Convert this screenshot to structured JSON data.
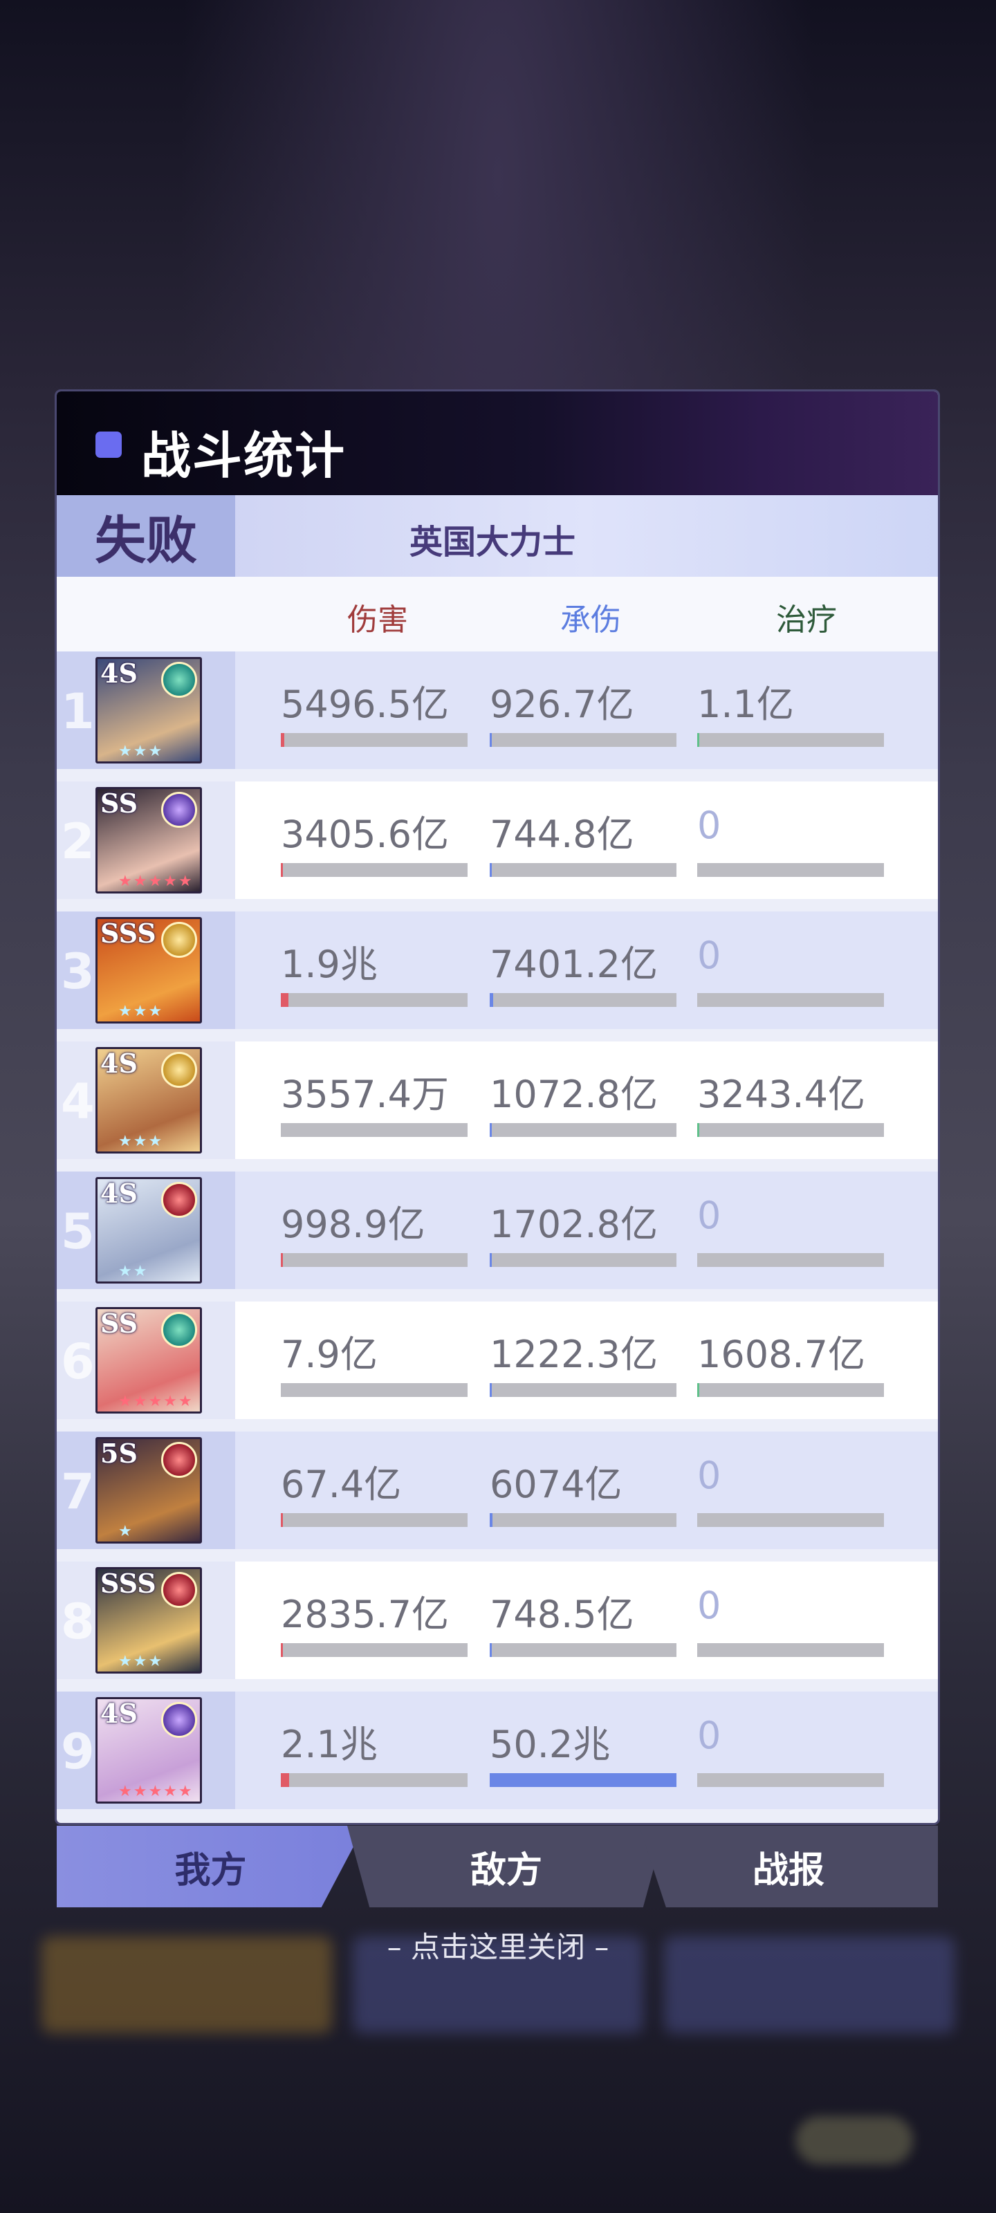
{
  "title": "战斗统计",
  "result": "失败",
  "opponent": "英国大力士",
  "columns": {
    "damage": "伤害",
    "tank": "承伤",
    "heal": "治疗"
  },
  "colors": {
    "damage": "#e05a66",
    "tank": "#6a86e6",
    "heal": "#5fc08a"
  },
  "rows": [
    {
      "rank": "1",
      "grade": "4S",
      "element": "wind",
      "stars": "★★★",
      "damage": "5496.5亿",
      "tank": "926.7亿",
      "heal": "1.1亿",
      "damage_ratio": 0.02,
      "tank_ratio": 0.01,
      "heal_ratio": 0.005
    },
    {
      "rank": "2",
      "grade": "SS",
      "element": "moon",
      "stars": "★★★★★",
      "damage": "3405.6亿",
      "tank": "744.8亿",
      "heal": "0",
      "damage_ratio": 0.012,
      "tank_ratio": 0.01,
      "heal_ratio": 0
    },
    {
      "rank": "3",
      "grade": "SSS",
      "element": "light",
      "stars": "★★★",
      "damage": "1.9兆",
      "tank": "7401.2亿",
      "heal": "0",
      "damage_ratio": 0.04,
      "tank_ratio": 0.02,
      "heal_ratio": 0
    },
    {
      "rank": "4",
      "grade": "4S",
      "element": "light",
      "stars": "★★★",
      "damage": "3557.4万",
      "tank": "1072.8亿",
      "heal": "3243.4亿",
      "damage_ratio": 0,
      "tank_ratio": 0.01,
      "heal_ratio": 0.01
    },
    {
      "rank": "5",
      "grade": "4S",
      "element": "fire",
      "stars": "★★",
      "damage": "998.9亿",
      "tank": "1702.8亿",
      "heal": "0",
      "damage_ratio": 0.005,
      "tank_ratio": 0.01,
      "heal_ratio": 0
    },
    {
      "rank": "6",
      "grade": "SS",
      "element": "wind",
      "stars": "★★★★★",
      "damage": "7.9亿",
      "tank": "1222.3亿",
      "heal": "1608.7亿",
      "damage_ratio": 0,
      "tank_ratio": 0.01,
      "heal_ratio": 0.01
    },
    {
      "rank": "7",
      "grade": "5S",
      "element": "fire",
      "stars": "★",
      "damage": "67.4亿",
      "tank": "6074亿",
      "heal": "0",
      "damage_ratio": 0.003,
      "tank_ratio": 0.015,
      "heal_ratio": 0
    },
    {
      "rank": "8",
      "grade": "SSS",
      "element": "fire",
      "stars": "★★★",
      "damage": "2835.7亿",
      "tank": "748.5亿",
      "heal": "0",
      "damage_ratio": 0.012,
      "tank_ratio": 0.01,
      "heal_ratio": 0
    },
    {
      "rank": "9",
      "grade": "4S",
      "element": "moon",
      "stars": "★★★★★",
      "damage": "2.1兆",
      "tank": "50.2兆",
      "heal": "0",
      "damage_ratio": 0.045,
      "tank_ratio": 1.0,
      "heal_ratio": 0
    }
  ],
  "tabs": [
    "我方",
    "敌方",
    "战报"
  ],
  "close_hint": "– 点击这里关闭 –"
}
